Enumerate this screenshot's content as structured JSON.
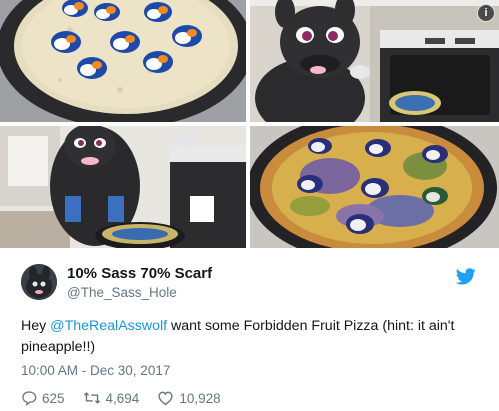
{
  "media": {
    "info_badge": "i",
    "tiles": [
      {
        "name": "raw-pizza-tide-pods"
      },
      {
        "name": "fursuit-at-oven"
      },
      {
        "name": "fursuit-holding-pizza"
      },
      {
        "name": "baked-pizza-closeup"
      }
    ]
  },
  "tweet": {
    "display_name": "10% Sass 70% Scarf",
    "handle": "@The_Sass_Hole",
    "text_prefix": "Hey ",
    "mention": "@TheRealAsswolf",
    "text_suffix": " want some Forbidden Fruit Pizza (hint: it ain't pineapple!!)",
    "timestamp": "10:00 AM - Dec 30, 2017",
    "replies": "625",
    "retweets": "4,694",
    "likes": "10,928"
  },
  "colors": {
    "twitter_blue": "#1da1f2",
    "mention": "#1b95e0",
    "secondary_text": "#657786"
  },
  "icons": [
    "info-icon",
    "twitter-bird-icon",
    "reply-icon",
    "retweet-icon",
    "like-heart-icon"
  ]
}
